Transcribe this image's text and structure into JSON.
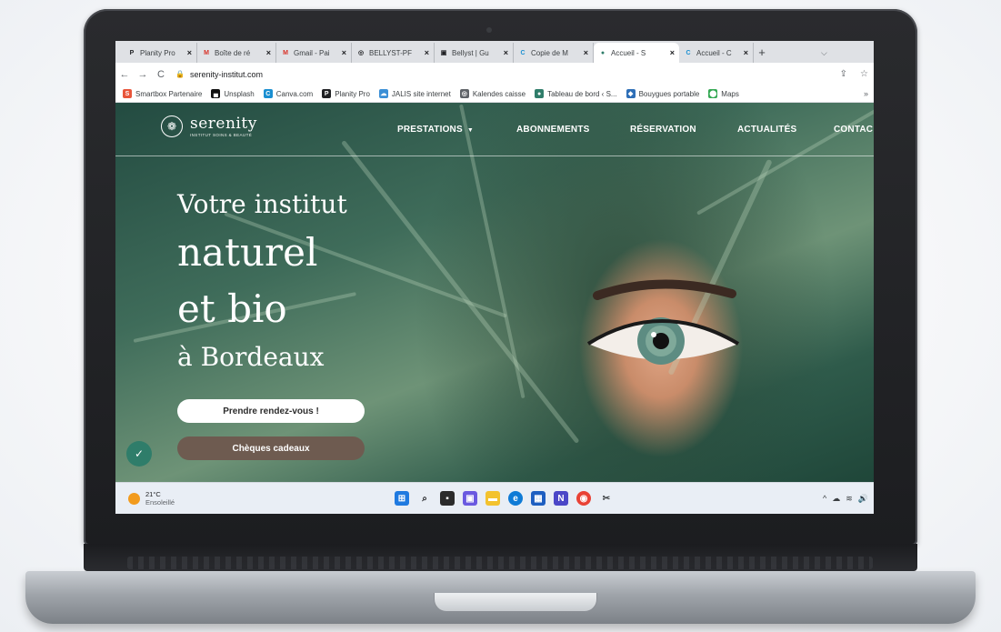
{
  "browser": {
    "tabs": [
      {
        "label": "Planity Pro",
        "icon": "planity-icon",
        "icon_glyph": "P",
        "icon_color": "#202124",
        "active": false
      },
      {
        "label": "Boîte de ré",
        "icon": "gmail-icon",
        "icon_glyph": "M",
        "icon_color": "#d93025",
        "active": false
      },
      {
        "label": "Gmail - Pai",
        "icon": "gmail-icon",
        "icon_glyph": "M",
        "icon_color": "#d93025",
        "active": false
      },
      {
        "label": "BELLYST-PF",
        "icon": "globe-icon",
        "icon_glyph": "◎",
        "icon_color": "#202124",
        "active": false
      },
      {
        "label": "Bellyst | Gu",
        "icon": "page-icon",
        "icon_glyph": "▣",
        "icon_color": "#202124",
        "active": false
      },
      {
        "label": "Copie de M",
        "icon": "canva-icon",
        "icon_glyph": "C",
        "icon_color": "#1a8fd1",
        "active": false
      },
      {
        "label": "Accueil - S",
        "icon": "site-icon",
        "icon_glyph": "●",
        "icon_color": "#2f7d6a",
        "active": true
      },
      {
        "label": "Accueil - C",
        "icon": "canva-icon",
        "icon_glyph": "C",
        "icon_color": "#1a8fd1",
        "active": false
      }
    ],
    "new_tab": "+",
    "tab_search": "⌵",
    "url": "serenity-institut.com",
    "bookmarks": [
      {
        "label": "Smartbox Partenaire",
        "icon": "smartbox-icon",
        "glyph": "S",
        "color": "#e8553a"
      },
      {
        "label": "Unsplash",
        "icon": "unsplash-icon",
        "glyph": "▄",
        "color": "#111111"
      },
      {
        "label": "Canva.com",
        "icon": "canva-icon",
        "glyph": "C",
        "color": "#1a8fd1"
      },
      {
        "label": "Planity Pro",
        "icon": "planity-icon",
        "glyph": "P",
        "color": "#202124"
      },
      {
        "label": "JALIS site internet",
        "icon": "cloud-icon",
        "glyph": "☁",
        "color": "#3b8fd6"
      },
      {
        "label": "Kalendes caisse",
        "icon": "globe-icon",
        "glyph": "◎",
        "color": "#5f6368"
      },
      {
        "label": "Tableau de bord ‹ S...",
        "icon": "site-icon",
        "glyph": "●",
        "color": "#2f7d6a"
      },
      {
        "label": "Bouygues portable",
        "icon": "bouygues-icon",
        "glyph": "◆",
        "color": "#2e6fb7"
      },
      {
        "label": "Maps",
        "icon": "maps-icon",
        "glyph": "⬤",
        "color": "#34a853"
      }
    ],
    "bookmarks_more": "»"
  },
  "site": {
    "logo_name": "serenity",
    "logo_tagline": "INSTITUT SOINS & BEAUTÉ",
    "nav": {
      "prestations": "PRESTATIONS",
      "abonnements": "ABONNEMENTS",
      "reservation": "RÉSERVATION",
      "actualites": "ACTUALITÉS",
      "contact": "CONTAC"
    },
    "hero": {
      "line1": "Votre institut",
      "line2": "naturel",
      "line3": "et bio",
      "line4": "à Bordeaux"
    },
    "cta_primary": "Prendre rendez-vous !",
    "cta_secondary": "Chèques cadeaux"
  },
  "taskbar": {
    "temperature": "21°C",
    "weather": "Ensoleillé"
  },
  "colors": {
    "accent": "#2f7d6a",
    "cta_secondary_bg": "#6e5b50"
  }
}
